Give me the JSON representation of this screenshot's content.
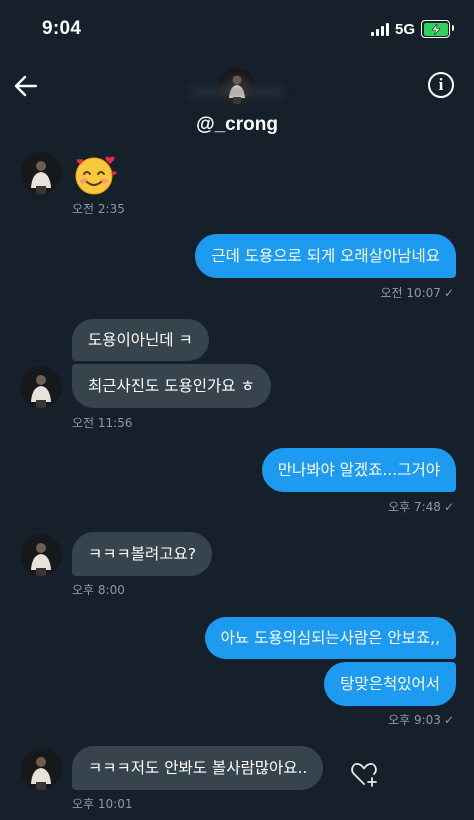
{
  "status_bar": {
    "time": "9:04",
    "network": "5G",
    "battery_charging": true
  },
  "header": {
    "back_icon": "back-arrow-icon",
    "info_icon": "info-icon",
    "username": "@_crong"
  },
  "colors": {
    "background": "#15202b",
    "incoming_bubble": "#38444d",
    "outgoing_bubble": "#1d9bf0",
    "meta_text": "#8b98a5",
    "battery": "#31d158"
  },
  "messages": [
    {
      "direction": "in",
      "type": "emoji",
      "emoji": "smiling-face-with-hearts"
    },
    {
      "direction": "in",
      "type": "meta",
      "time": "오전 2:35"
    },
    {
      "direction": "out",
      "type": "text",
      "text": "근데 도용으로 되게 오래살아남네요"
    },
    {
      "direction": "out",
      "type": "meta",
      "time": "오전 10:07",
      "read": true
    },
    {
      "direction": "in",
      "type": "text",
      "text": "도용이아닌데 ㅋ"
    },
    {
      "direction": "in",
      "type": "text",
      "text": "최근사진도 도용인가요 ㅎ"
    },
    {
      "direction": "in",
      "type": "meta",
      "time": "오전 11:56"
    },
    {
      "direction": "out",
      "type": "text",
      "text": "만나봐야 알겠죠...그거야"
    },
    {
      "direction": "out",
      "type": "meta",
      "time": "오후 7:48",
      "read": true
    },
    {
      "direction": "in",
      "type": "text",
      "text": "ㅋㅋㅋ볼려고요?"
    },
    {
      "direction": "in",
      "type": "meta",
      "time": "오후 8:00"
    },
    {
      "direction": "out",
      "type": "text",
      "text": "아뇨 도용의심되는사람은 안보죠,,"
    },
    {
      "direction": "out",
      "type": "text",
      "text": "탕맞은척있어서"
    },
    {
      "direction": "out",
      "type": "meta",
      "time": "오후 9:03",
      "read": true
    },
    {
      "direction": "in",
      "type": "text",
      "text": "ㅋㅋㅋ저도 안봐도 볼사람많아요.."
    },
    {
      "direction": "in",
      "type": "meta",
      "time": "오후 10:01"
    }
  ],
  "reaction_icon": "heart-add-icon"
}
